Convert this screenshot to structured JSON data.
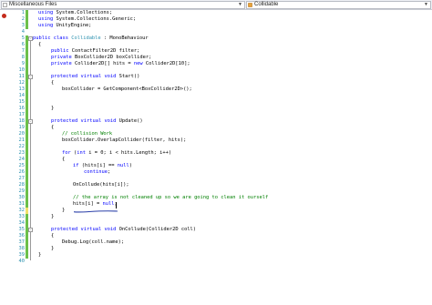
{
  "navbar": {
    "left_dropdown": "Miscellaneous Files",
    "right_dropdown": "Collidable"
  },
  "line_numbers": [
    "1",
    "2",
    "3",
    "4",
    "5",
    "6",
    "7",
    "8",
    "9",
    "10",
    "11",
    "12",
    "13",
    "14",
    "15",
    "16",
    "17",
    "18",
    "19",
    "20",
    "21",
    "22",
    "23",
    "24",
    "25",
    "26",
    "27",
    "28",
    "29",
    "30",
    "31",
    "32",
    "33",
    "34",
    "35",
    "36",
    "37",
    "38",
    "39",
    "40"
  ],
  "code": {
    "l1": [
      "using",
      "System.Collections;"
    ],
    "l2": [
      "using",
      "System.Collections.Generic;"
    ],
    "l3": [
      "using",
      "UnityEngine;"
    ],
    "l5": [
      "public",
      "class",
      "Collidable",
      ": MonoBehaviour"
    ],
    "l6": "{",
    "l7": [
      "public",
      "ContactFilter2D filter;"
    ],
    "l8": [
      "private",
      "BoxCollider2D boxCollider;"
    ],
    "l9": [
      "private",
      "Collider2D[] hits = ",
      "new",
      "Collider2D[10];"
    ],
    "l11": [
      "protected",
      "virtual",
      "void",
      "Start()"
    ],
    "l12": "{",
    "l13": "boxCollider = GetComponent<BoxCollider2D>();",
    "l16": "}",
    "l18": [
      "protected",
      "virtual",
      "void",
      "Update()"
    ],
    "l19": "{",
    "l20": "// collision Work",
    "l21": "boxCollider.OverlapCollider(filter, hits);",
    "l23": [
      "for",
      " (",
      "int",
      " i = 0; i < hits.Length; i++)"
    ],
    "l24": "{",
    "l25": [
      "if",
      " (hits[i] == ",
      "null",
      ")"
    ],
    "l26": [
      "continue",
      ";"
    ],
    "l28": "OnCollude(hits[i]);",
    "l30": "// the array is not cleaned up so we are going to clean it ourself",
    "l31": [
      "hits[i] = ",
      "null",
      ";"
    ],
    "l32": "}",
    "l33": "}",
    "l35": [
      "protected",
      "virtual",
      "void",
      "OnCollude(Collider2D coll)"
    ],
    "l36": "{",
    "l37": "Debug.Log(coll.name);",
    "l38": "}",
    "l39": "}"
  }
}
